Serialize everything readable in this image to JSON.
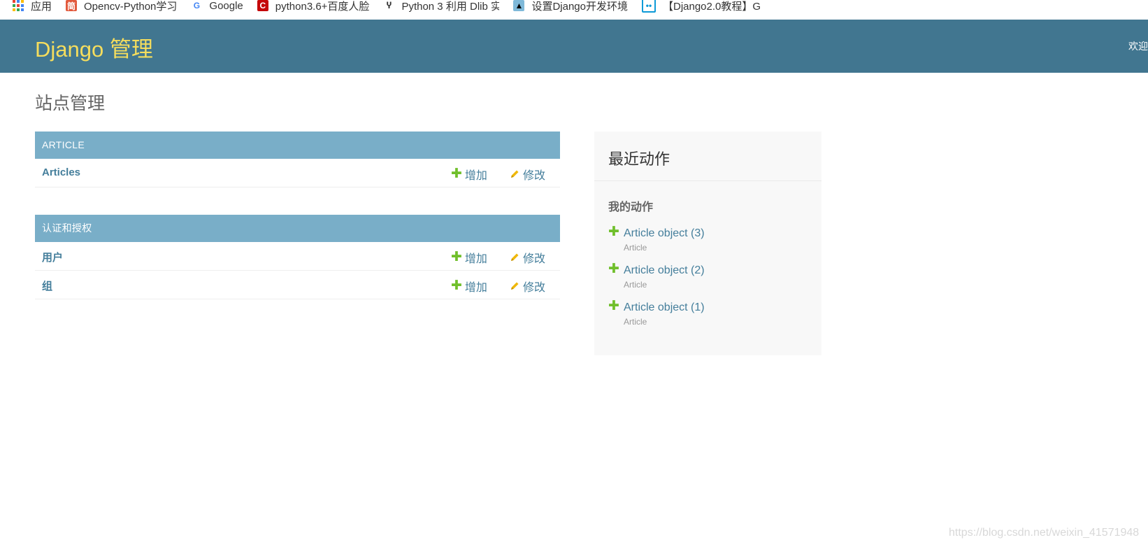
{
  "bookmarks": [
    {
      "icon": "apps-icon",
      "label": "应用"
    },
    {
      "icon": "jianshu-icon",
      "label": "Opencv-Python学习"
    },
    {
      "icon": "google-icon",
      "label": "Google"
    },
    {
      "icon": "csdn-icon",
      "label": "python3.6+百度人脸"
    },
    {
      "icon": "dlib-icon",
      "label": "Python 3 利用 Dlib 实"
    },
    {
      "icon": "django-bookmark-icon",
      "label": "设置Django开发环境"
    },
    {
      "icon": "bilibili-icon",
      "label": "【Django2.0教程】G"
    }
  ],
  "header": {
    "branding": "Django 管理",
    "user_tools": "欢迎"
  },
  "page_title": "站点管理",
  "modules": [
    {
      "caption": "ARTICLE",
      "models": [
        {
          "name": "Articles",
          "add_label": "增加",
          "change_label": "修改"
        }
      ]
    },
    {
      "caption": "认证和授权",
      "models": [
        {
          "name": "用户",
          "add_label": "增加",
          "change_label": "修改"
        },
        {
          "name": "组",
          "add_label": "增加",
          "change_label": "修改"
        }
      ]
    }
  ],
  "recent_actions": {
    "title": "最近动作",
    "subtitle": "我的动作",
    "items": [
      {
        "object": "Article object (3)",
        "type": "Article"
      },
      {
        "object": "Article object (2)",
        "type": "Article"
      },
      {
        "object": "Article object (1)",
        "type": "Article"
      }
    ]
  },
  "watermark": "https://blog.csdn.net/weixin_41571948",
  "colors": {
    "header_bg": "#417690",
    "branding": "#f5dd5d",
    "module_head_bg": "#79aec8",
    "link": "#447e9b",
    "add_icon": "#70bf2b",
    "change_icon": "#efb80b"
  }
}
